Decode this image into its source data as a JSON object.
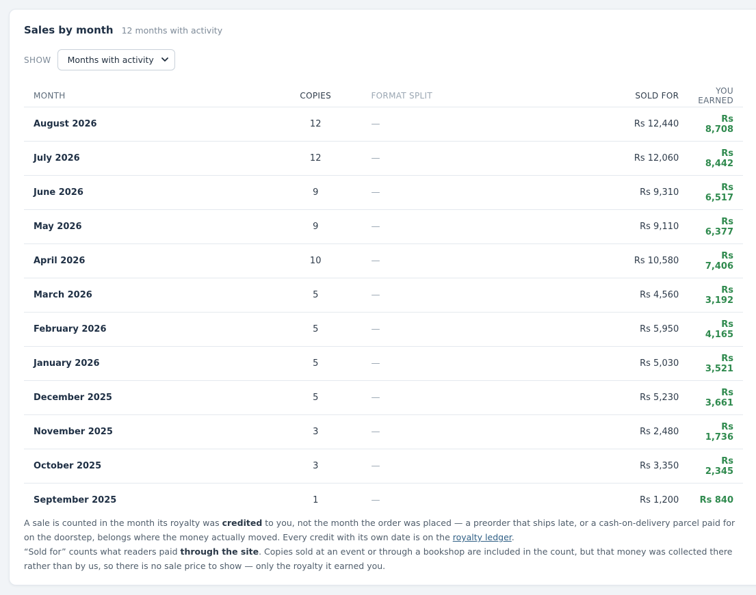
{
  "header": {
    "title": "Sales by month",
    "subtitle": "12 months with activity"
  },
  "filter": {
    "label": "SHOW",
    "selected": "Months with activity",
    "chevron_icon": "chevron-down-icon"
  },
  "table": {
    "columns": {
      "month": "MONTH",
      "copies": "COPIES",
      "split": "FORMAT SPLIT",
      "sold": "SOLD FOR",
      "earned": "YOU EARNED"
    },
    "rows": [
      {
        "month": "August 2026",
        "copies": "12",
        "split": "—",
        "sold": "Rs 12,440",
        "earned": "Rs 8,708"
      },
      {
        "month": "July 2026",
        "copies": "12",
        "split": "—",
        "sold": "Rs 12,060",
        "earned": "Rs 8,442"
      },
      {
        "month": "June 2026",
        "copies": "9",
        "split": "—",
        "sold": "Rs 9,310",
        "earned": "Rs 6,517"
      },
      {
        "month": "May 2026",
        "copies": "9",
        "split": "—",
        "sold": "Rs 9,110",
        "earned": "Rs 6,377"
      },
      {
        "month": "April 2026",
        "copies": "10",
        "split": "—",
        "sold": "Rs 10,580",
        "earned": "Rs 7,406"
      },
      {
        "month": "March 2026",
        "copies": "5",
        "split": "—",
        "sold": "Rs 4,560",
        "earned": "Rs 3,192"
      },
      {
        "month": "February 2026",
        "copies": "5",
        "split": "—",
        "sold": "Rs 5,950",
        "earned": "Rs 4,165"
      },
      {
        "month": "January 2026",
        "copies": "5",
        "split": "—",
        "sold": "Rs 5,030",
        "earned": "Rs 3,521"
      },
      {
        "month": "December 2025",
        "copies": "5",
        "split": "—",
        "sold": "Rs 5,230",
        "earned": "Rs 3,661"
      },
      {
        "month": "November 2025",
        "copies": "3",
        "split": "—",
        "sold": "Rs 2,480",
        "earned": "Rs 1,736"
      },
      {
        "month": "October 2025",
        "copies": "3",
        "split": "—",
        "sold": "Rs 3,350",
        "earned": "Rs 2,345"
      },
      {
        "month": "September 2025",
        "copies": "1",
        "split": "—",
        "sold": "Rs 1,200",
        "earned": "Rs 840"
      }
    ]
  },
  "notes": {
    "p1_a": "A sale is counted in the month its royalty was ",
    "p1_b": "credited",
    "p1_c": " to you, not the month the order was placed — a preorder that ships late, or a cash-on-delivery parcel paid for on the doorstep, belongs where the money actually moved. Every credit with its own date is on the ",
    "p1_link": "royalty ledger",
    "p1_d": ".",
    "p2_a": "“Sold for” counts what readers paid ",
    "p2_b": "through the site",
    "p2_c": ". Copies sold at an event or through a bookshop are included in the count, but that money was collected there rather than by us, so there is no sale price to show — only the royalty it earned you."
  },
  "colors": {
    "earned": "#2f8a4e",
    "background": "#f1f4f7",
    "link": "#2f5f85"
  }
}
